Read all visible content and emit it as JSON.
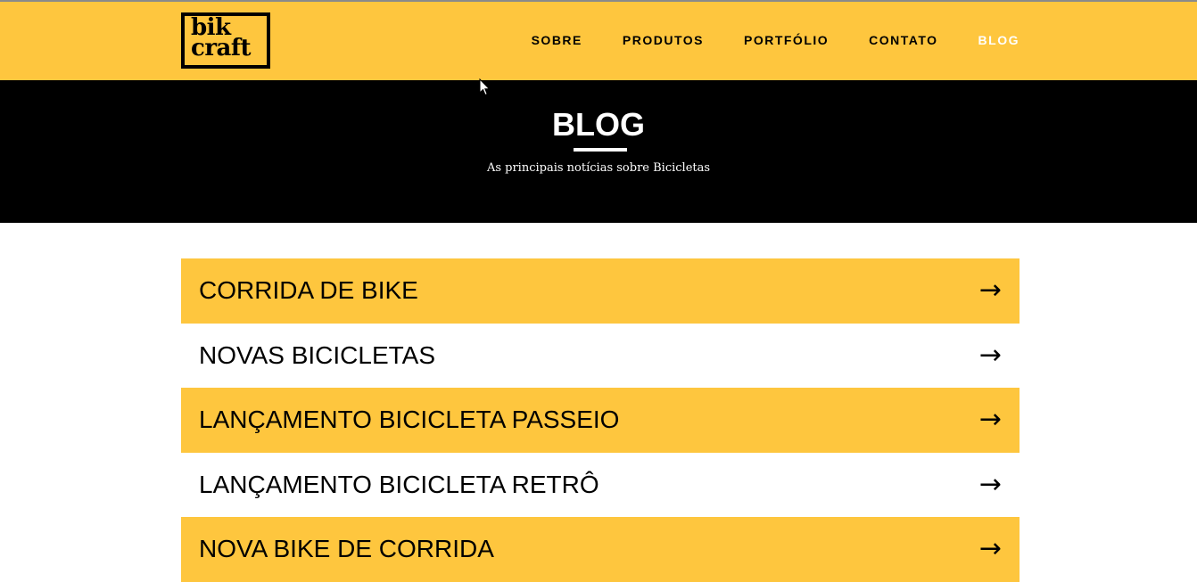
{
  "header": {
    "logo_line1": "bik",
    "logo_line2": "craft",
    "nav": [
      {
        "label": "SOBRE",
        "active": false
      },
      {
        "label": "PRODUTOS",
        "active": false
      },
      {
        "label": "PORTFÓLIO",
        "active": false
      },
      {
        "label": "CONTATO",
        "active": false
      },
      {
        "label": "BLOG",
        "active": true
      }
    ]
  },
  "hero": {
    "title": "BLOG",
    "subtitle": "As principais notícias sobre Bicicletas"
  },
  "posts": [
    {
      "title": "CORRIDA DE BIKE",
      "arrow": "→"
    },
    {
      "title": "NOVAS BICICLETAS",
      "arrow": "→"
    },
    {
      "title": "LANÇAMENTO BICICLETA PASSEIO",
      "arrow": "→"
    },
    {
      "title": "LANÇAMENTO BICICLETA RETRÔ",
      "arrow": "→"
    },
    {
      "title": "NOVA BIKE DE CORRIDA",
      "arrow": "→"
    }
  ],
  "colors": {
    "brand_yellow": "#fec63e",
    "hero_background": "#000000",
    "text": "#000000",
    "active_nav": "#ffffff"
  },
  "icons": {
    "post_arrow": "arrow-right-icon",
    "pointer": "cursor-icon"
  }
}
